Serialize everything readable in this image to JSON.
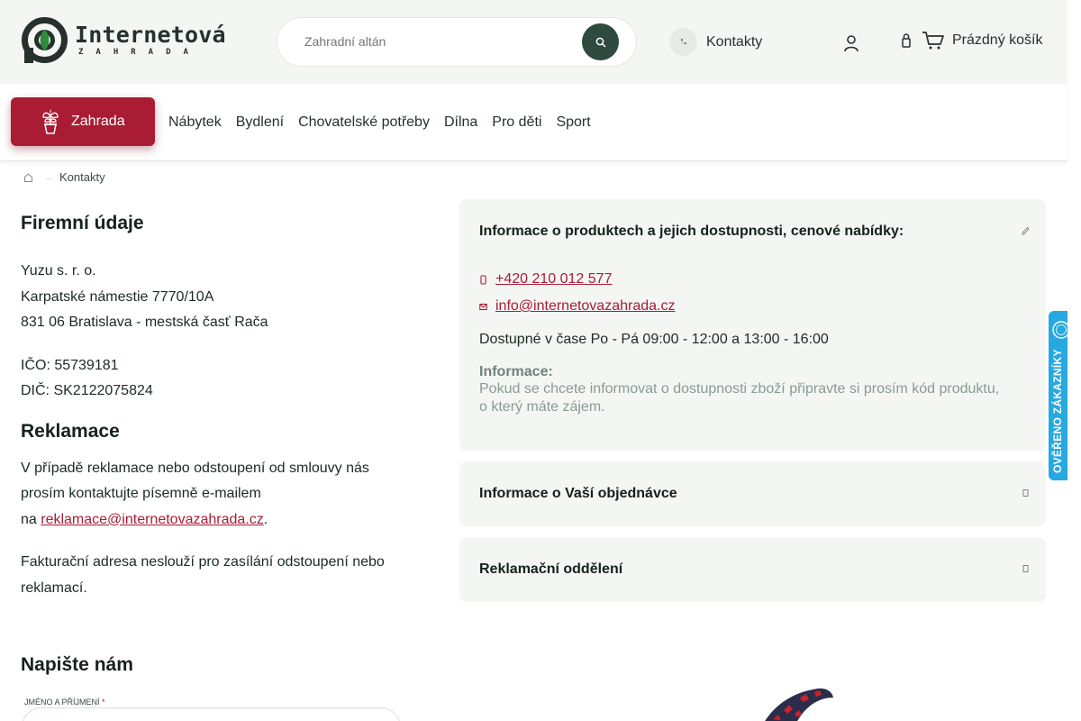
{
  "header": {
    "logo": {
      "main": "Internetová",
      "sub": "ZAHRADA"
    },
    "search": {
      "placeholder": "Zahradní altán"
    },
    "contacts_label": "Kontakty",
    "cart_label": "Prázdný košík"
  },
  "nav": {
    "primary_label": "Zahrada",
    "items": [
      "Nábytek",
      "Bydlení",
      "Chovatelské potřeby",
      "Dílna",
      "Pro děti",
      "Sport"
    ]
  },
  "breadcrumb": {
    "current": "Kontakty"
  },
  "company": {
    "heading": "Firemní údaje",
    "name": "Yuzu s. r. o.",
    "street": "Karpatské námestie 7770/10A",
    "city": "831 06 Bratislava - mestská časť Rača",
    "ico": "IČO: 55739181",
    "dic": "DIČ: SK2122075824"
  },
  "complaints": {
    "heading": "Reklamace",
    "text_1": "V případě reklamace nebo odstoupení od smlouvy nás",
    "text_2": "prosím kontaktujte písemně e-mailem",
    "text_3": "na",
    "email": "reklamace@internetovazahrada.cz",
    "period": ".",
    "note_1": "Fakturační adresa neslouží pro zasílání odstoupení nebo",
    "note_2": "reklamací."
  },
  "write_us": {
    "heading": "Napište nám",
    "name_label": "JMÉNO A PŘÍJMENÍ",
    "required_mark": "*"
  },
  "accordion": [
    {
      "title": "Informace o produktech a jejich dostupnosti, cenové nabídky:",
      "expanded": true,
      "phone": "+420 210 012 577",
      "email": "info@internetovazahrada.cz",
      "hours": "Dostupné v čase Po - Pá 09:00 - 12:00 a 13:00 - 16:00",
      "info_label": "Informace:",
      "info_line_1": "Pokud se chcete informovat o dostupnosti zboží připravte si prosím kód produktu,",
      "info_line_2": "o který máte zájem."
    },
    {
      "title": "Informace o Vaší objednávce",
      "expanded": false
    },
    {
      "title": "Reklamační oddělení",
      "expanded": false
    }
  ],
  "badge": {
    "text": "OVĚŘENO ZÁKAZNÍKY"
  },
  "colors": {
    "brand_red": "#a91c34",
    "dark_green": "#2f4a3e",
    "badge_blue": "#25a9e0"
  }
}
